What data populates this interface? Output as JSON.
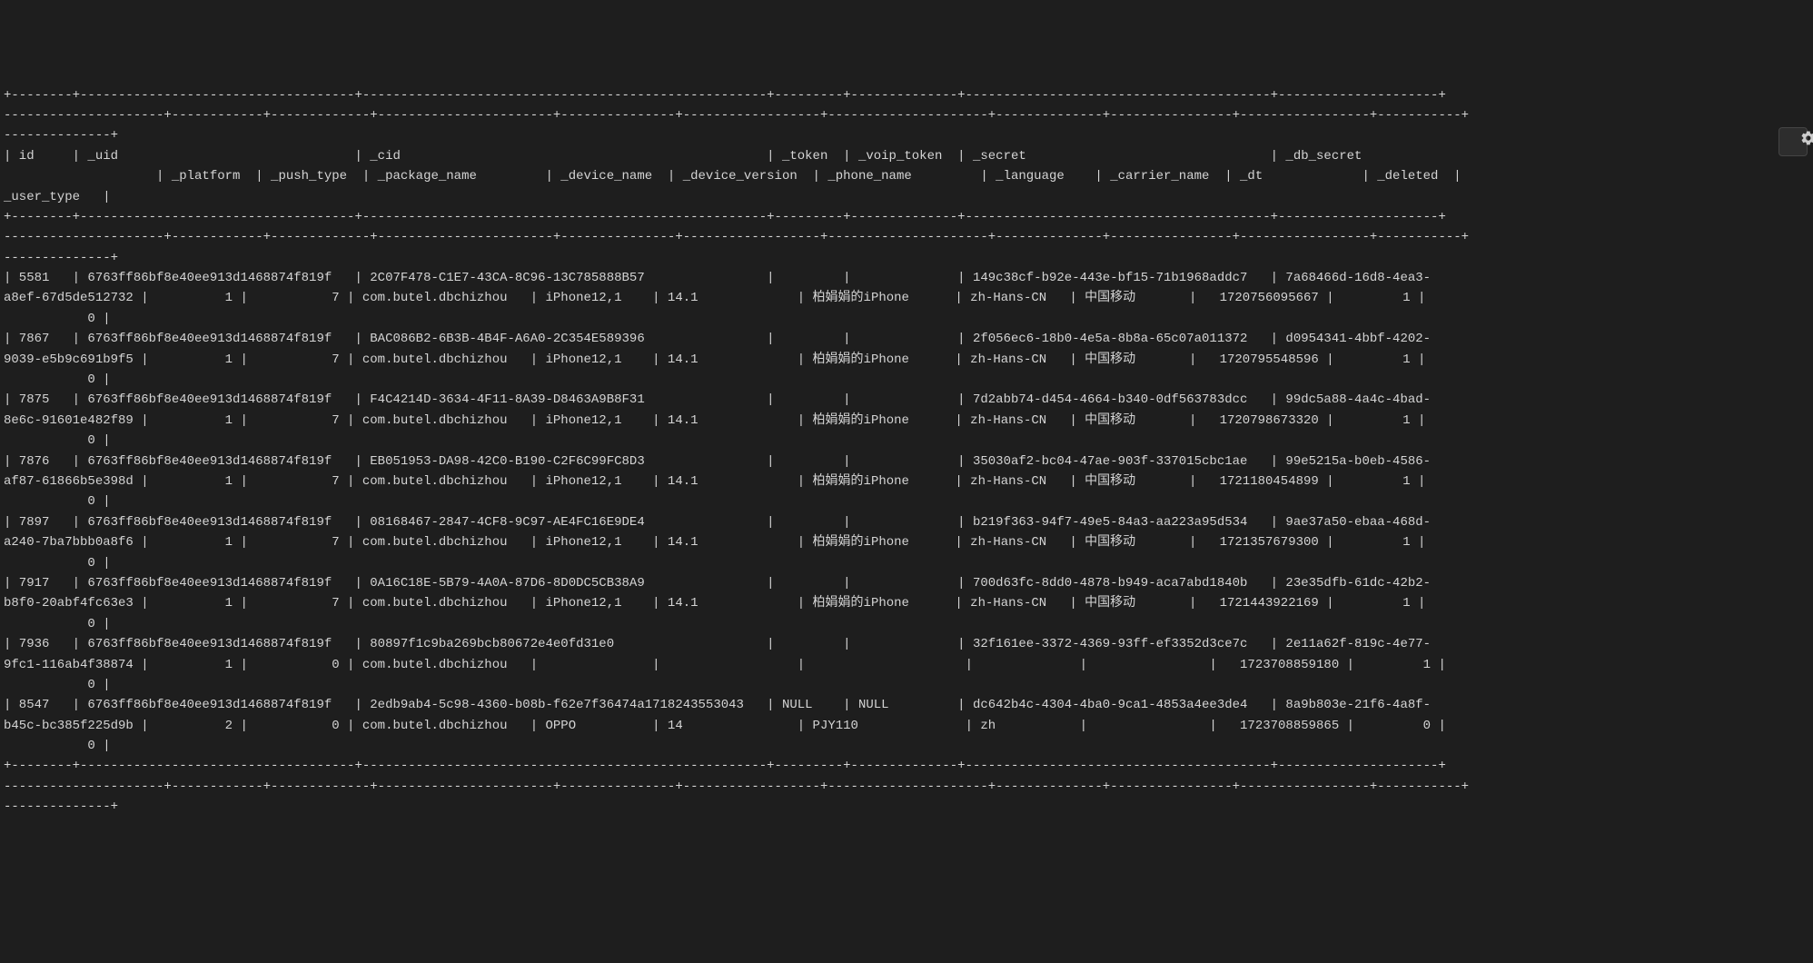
{
  "gear_tooltip": "Settings",
  "columns": [
    "id",
    "_uid",
    "_cid",
    "_token",
    "_voip_token",
    "_secret",
    "_db_secret",
    "_platform",
    "_push_type",
    "_package_name",
    "_device_name",
    "_device_version",
    "_phone_name",
    "_language",
    "_carrier_name",
    "_dt",
    "_deleted",
    "_user_type"
  ],
  "rows": [
    {
      "id": "5581",
      "_uid": "6763ff86bf8e40ee913d1468874f819f",
      "_cid": "2C07F478-C1E7-43CA-8C96-13C785888B57",
      "_token": "",
      "_voip_token": "",
      "_secret": "149c38cf-b92e-443e-bf15-71b1968addc7",
      "_db_secret": "7a68466d-16d8-4ea3-a8ef-67d5de512732",
      "_platform": "1",
      "_push_type": "7",
      "_package_name": "com.butel.dbchizhou",
      "_device_name": "iPhone12,1",
      "_device_version": "14.1",
      "_phone_name": "柏娟娟的iPhone",
      "_language": "zh-Hans-CN",
      "_carrier_name": "中国移动",
      "_dt": "1720756095667",
      "_deleted": "1",
      "_user_type": "0"
    },
    {
      "id": "7867",
      "_uid": "6763ff86bf8e40ee913d1468874f819f",
      "_cid": "BAC086B2-6B3B-4B4F-A6A0-2C354E589396",
      "_token": "",
      "_voip_token": "",
      "_secret": "2f056ec6-18b0-4e5a-8b8a-65c07a011372",
      "_db_secret": "d0954341-4bbf-4202-9039-e5b9c691b9f5",
      "_platform": "1",
      "_push_type": "7",
      "_package_name": "com.butel.dbchizhou",
      "_device_name": "iPhone12,1",
      "_device_version": "14.1",
      "_phone_name": "柏娟娟的iPhone",
      "_language": "zh-Hans-CN",
      "_carrier_name": "中国移动",
      "_dt": "1720795548596",
      "_deleted": "1",
      "_user_type": "0"
    },
    {
      "id": "7875",
      "_uid": "6763ff86bf8e40ee913d1468874f819f",
      "_cid": "F4C4214D-3634-4F11-8A39-D8463A9B8F31",
      "_token": "",
      "_voip_token": "",
      "_secret": "7d2abb74-d454-4664-b340-0df563783dcc",
      "_db_secret": "99dc5a88-4a4c-4bad-8e6c-91601e482f89",
      "_platform": "1",
      "_push_type": "7",
      "_package_name": "com.butel.dbchizhou",
      "_device_name": "iPhone12,1",
      "_device_version": "14.1",
      "_phone_name": "柏娟娟的iPhone",
      "_language": "zh-Hans-CN",
      "_carrier_name": "中国移动",
      "_dt": "1720798673320",
      "_deleted": "1",
      "_user_type": "0"
    },
    {
      "id": "7876",
      "_uid": "6763ff86bf8e40ee913d1468874f819f",
      "_cid": "EB051953-DA98-42C0-B190-C2F6C99FC8D3",
      "_token": "",
      "_voip_token": "",
      "_secret": "35030af2-bc04-47ae-903f-337015cbc1ae",
      "_db_secret": "99e5215a-b0eb-4586-af87-61866b5e398d",
      "_platform": "1",
      "_push_type": "7",
      "_package_name": "com.butel.dbchizhou",
      "_device_name": "iPhone12,1",
      "_device_version": "14.1",
      "_phone_name": "柏娟娟的iPhone",
      "_language": "zh-Hans-CN",
      "_carrier_name": "中国移动",
      "_dt": "1721180454899",
      "_deleted": "1",
      "_user_type": "0"
    },
    {
      "id": "7897",
      "_uid": "6763ff86bf8e40ee913d1468874f819f",
      "_cid": "08168467-2847-4CF8-9C97-AE4FC16E9DE4",
      "_token": "",
      "_voip_token": "",
      "_secret": "b219f363-94f7-49e5-84a3-aa223a95d534",
      "_db_secret": "9ae37a50-ebaa-468d-a240-7ba7bbb0a8f6",
      "_platform": "1",
      "_push_type": "7",
      "_package_name": "com.butel.dbchizhou",
      "_device_name": "iPhone12,1",
      "_device_version": "14.1",
      "_phone_name": "柏娟娟的iPhone",
      "_language": "zh-Hans-CN",
      "_carrier_name": "中国移动",
      "_dt": "1721357679300",
      "_deleted": "1",
      "_user_type": "0"
    },
    {
      "id": "7917",
      "_uid": "6763ff86bf8e40ee913d1468874f819f",
      "_cid": "0A16C18E-5B79-4A0A-87D6-8D0DC5CB38A9",
      "_token": "",
      "_voip_token": "",
      "_secret": "700d63fc-8dd0-4878-b949-aca7abd1840b",
      "_db_secret": "23e35dfb-61dc-42b2-b8f0-20abf4fc63e3",
      "_platform": "1",
      "_push_type": "7",
      "_package_name": "com.butel.dbchizhou",
      "_device_name": "iPhone12,1",
      "_device_version": "14.1",
      "_phone_name": "柏娟娟的iPhone",
      "_language": "zh-Hans-CN",
      "_carrier_name": "中国移动",
      "_dt": "1721443922169",
      "_deleted": "1",
      "_user_type": "0"
    },
    {
      "id": "7936",
      "_uid": "6763ff86bf8e40ee913d1468874f819f",
      "_cid": "80897f1c9ba269bcb80672e4e0fd31e0",
      "_token": "",
      "_voip_token": "",
      "_secret": "32f161ee-3372-4369-93ff-ef3352d3ce7c",
      "_db_secret": "2e11a62f-819c-4e77-9fc1-116ab4f38874",
      "_platform": "1",
      "_push_type": "0",
      "_package_name": "com.butel.dbchizhou",
      "_device_name": "",
      "_device_version": "",
      "_phone_name": "",
      "_language": "",
      "_carrier_name": "",
      "_dt": "1723708859180",
      "_deleted": "1",
      "_user_type": "0"
    },
    {
      "id": "8547",
      "_uid": "6763ff86bf8e40ee913d1468874f819f",
      "_cid": "2edb9ab4-5c98-4360-b08b-f62e7f36474a1718243553043",
      "_token": "NULL",
      "_voip_token": "NULL",
      "_secret": "dc642b4c-4304-4ba0-9ca1-4853a4ee3de4",
      "_db_secret": "8a9b803e-21f6-4a8f-b45c-bc385f225d9b",
      "_platform": "2",
      "_push_type": "0",
      "_package_name": "com.butel.dbchizhou",
      "_device_name": "OPPO",
      "_device_version": "14",
      "_phone_name": "PJY110",
      "_language": "zh",
      "_carrier_name": "",
      "_dt": "1723708859865",
      "_deleted": "0",
      "_user_type": "0"
    }
  ],
  "widths": {
    "id": 6,
    "_uid": 34,
    "_cid": 51,
    "_token": 8,
    "_voip_token": 13,
    "_secret": 38,
    "_db_secret": 19,
    "_platform": 11,
    "_push_type": 12,
    "_package_name": 21,
    "_device_name": 14,
    "_device_version": 17,
    "_phone_name": 19,
    "_language": 12,
    "_carrier_name": 15,
    "_dt": 15,
    "_deleted": 10,
    "_user_type": 12
  }
}
